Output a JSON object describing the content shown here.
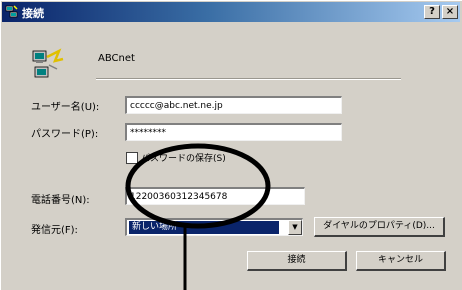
{
  "window": {
    "title": "接続",
    "help_label": "?",
    "close_label": "×"
  },
  "connection": {
    "name": "ABCnet"
  },
  "form": {
    "username_label": "ユーザー名(U):",
    "username_value": "ccccc@abc.net.ne.jp",
    "password_label": "パスワード(P):",
    "password_value": "********",
    "save_password_label": "パスワードの保存(S)",
    "save_password_checked": false,
    "phone_label": "電話番号(N):",
    "phone_value": "12200360312345678",
    "dial_from_label": "発信元(F):",
    "dial_from_value": "新しい場所"
  },
  "buttons": {
    "dial_properties": "ダイヤルのプロパティ(D)...",
    "connect": "接続",
    "cancel": "キャンセル"
  },
  "colors": {
    "title_bar": "#0a246a",
    "dialog_face": "#d4d0c8",
    "selection": "#0a246a"
  }
}
